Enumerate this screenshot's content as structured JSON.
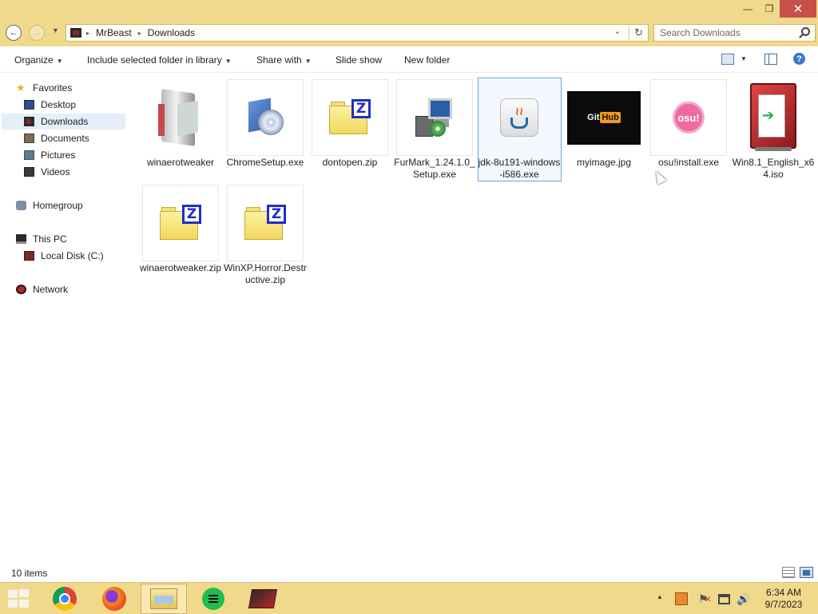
{
  "window": {
    "min_glyph": "—",
    "max_glyph": "❐",
    "close_glyph": "✕"
  },
  "address": {
    "back_glyph": "←",
    "forward_glyph": "→",
    "recent_glyph": "▼",
    "breadcrumb": [
      "MrBeast",
      "Downloads"
    ],
    "separator": "▸",
    "dropdown_glyph": "⌄",
    "refresh_glyph": "↻",
    "search_placeholder": "Search Downloads"
  },
  "commands": {
    "organize": "Organize",
    "include": "Include selected folder in library",
    "share": "Share with",
    "slideshow": "Slide show",
    "new_folder": "New folder",
    "caret": "▼",
    "help": "?"
  },
  "nav": {
    "favorites": "Favorites",
    "desktop": "Desktop",
    "downloads": "Downloads",
    "documents": "Documents",
    "pictures": "Pictures",
    "videos": "Videos",
    "homegroup": "Homegroup",
    "this_pc": "This PC",
    "local_disk": "Local Disk (C:)",
    "network": "Network",
    "star_glyph": "★"
  },
  "files": [
    {
      "name": "winaerotweaker",
      "icon": "setup-icon"
    },
    {
      "name": "ChromeSetup.exe",
      "icon": "chrome-setup-icon"
    },
    {
      "name": "dontopen.zip",
      "icon": "zip-folder-icon"
    },
    {
      "name": "FurMark_1.24.1.0_Setup.exe",
      "icon": "installer-icon"
    },
    {
      "name": "jdk-8u191-windows-i586.exe",
      "icon": "java-icon"
    },
    {
      "name": "myimage.jpg",
      "icon": "image-thumbnail"
    },
    {
      "name": "osu!install.exe",
      "icon": "osu-icon"
    },
    {
      "name": "Win8.1_English_x64.iso",
      "icon": "iso-disc-icon"
    },
    {
      "name": "winaerotweaker.zip",
      "icon": "zip-folder-icon"
    },
    {
      "name": "WinXP.Horror.Destructive.zip",
      "icon": "zip-folder-icon"
    }
  ],
  "thumb_text": {
    "zip_letter": "Z",
    "java_steam": "≀≀",
    "github_left": "Git",
    "github_right": "Hub",
    "osu_text": "osu!",
    "iso_arrow": "➔"
  },
  "status": {
    "count": "10 items"
  },
  "tray": {
    "up_glyph": "▲",
    "flag_glyph": "⚑",
    "flag_x": "✕",
    "volume_glyph": "🔊",
    "time": "6:34 AM",
    "date": "9/7/2023"
  },
  "colors": {
    "accent": "#f1d98c",
    "selection": "#66a7e8",
    "close": "#c7504b"
  }
}
